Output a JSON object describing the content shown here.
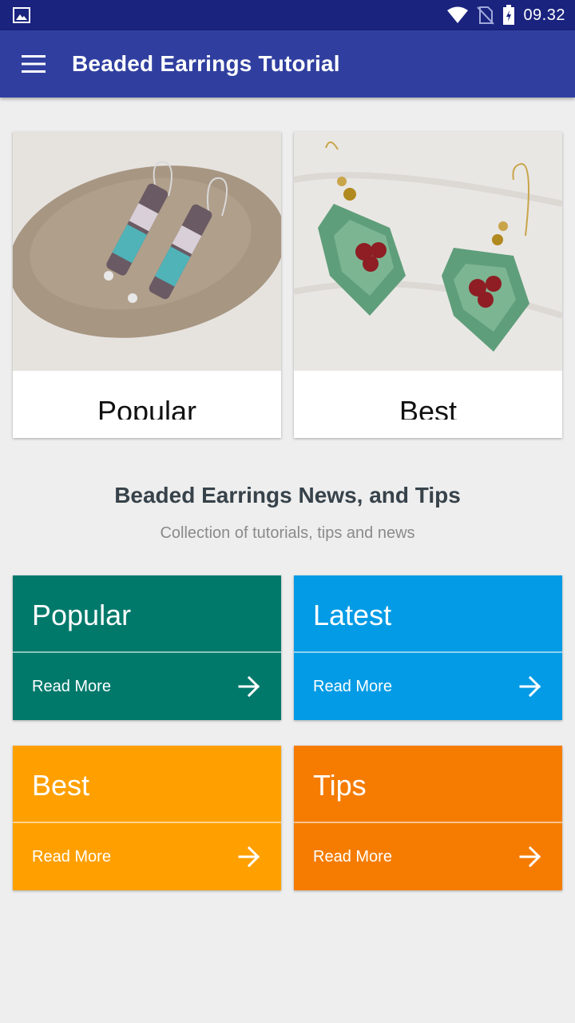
{
  "status_bar": {
    "time": "09.32",
    "icons": [
      "image-notification-icon",
      "wifi-icon",
      "no-sim-icon",
      "battery-icon"
    ]
  },
  "app_bar": {
    "title": "Beaded Earrings Tutorial",
    "menu_icon": "hamburger-menu-icon"
  },
  "image_cards": [
    {
      "label": "Popular"
    },
    {
      "label": "Best"
    }
  ],
  "section": {
    "title": "Beaded Earrings News, and Tips",
    "subtitle": "Collection of tutorials, tips and news"
  },
  "tiles": [
    {
      "title": "Popular",
      "action": "Read More",
      "color": "#00796b"
    },
    {
      "title": "Latest",
      "action": "Read More",
      "color": "#039be5"
    },
    {
      "title": "Best",
      "action": "Read More",
      "color": "#ffa000"
    },
    {
      "title": "Tips",
      "action": "Read More",
      "color": "#f57c00"
    }
  ]
}
